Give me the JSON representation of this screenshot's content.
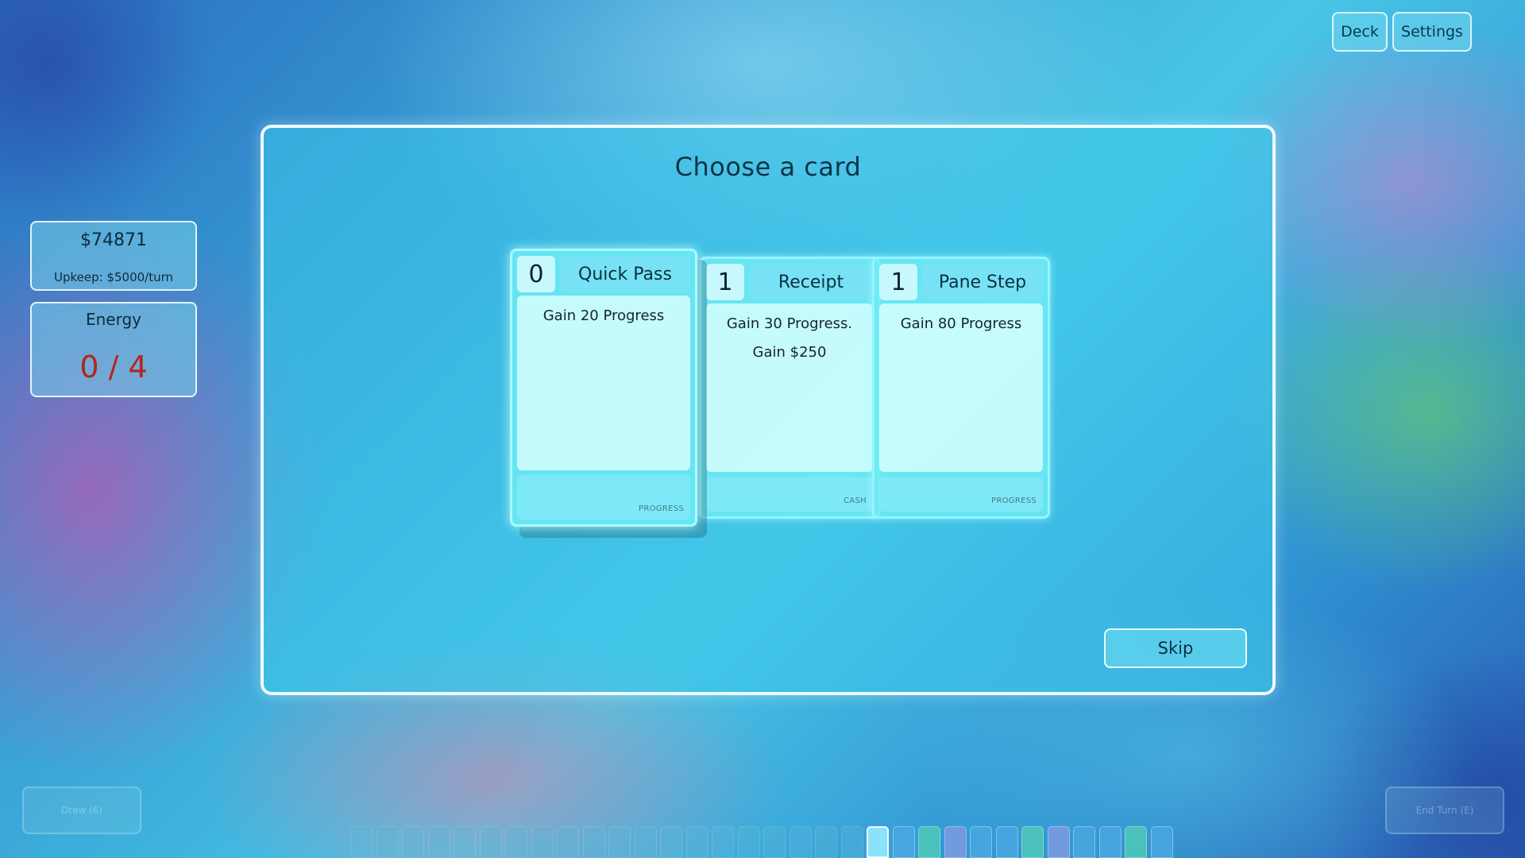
{
  "top_bar": {
    "deck_label": "Deck",
    "settings_label": "Settings"
  },
  "stats": {
    "money": "$74871",
    "upkeep": "Upkeep: $5000/turn",
    "energy_label": "Energy",
    "energy_value": "0 / 4"
  },
  "modal": {
    "title": "Choose a card",
    "skip_label": "Skip",
    "cards": [
      {
        "cost": "0",
        "name": "Quick Pass",
        "text": "Gain 20 Progress",
        "tag": "PROGRESS"
      },
      {
        "cost": "1",
        "name": "Receipt",
        "text": "Gain 30 Progress. Gain $250",
        "tag": "CASH"
      },
      {
        "cost": "1",
        "name": "Pane Step",
        "text": "Gain 80 Progress",
        "tag": "PROGRESS"
      }
    ]
  },
  "bottom": {
    "draw_label": "Draw (6)",
    "end_turn_label": "End Turn (E)"
  },
  "track": {
    "cell_count": 32,
    "current_index": 20,
    "colors": {
      "empty": "#5fb7d6",
      "current": "#8fe6ff",
      "blue": "#4aa8e0",
      "teal": "#4fc9b8",
      "purple": "#7d9be0"
    },
    "filled": [
      "blue",
      "teal",
      "purple",
      "blue",
      "blue",
      "teal",
      "purple",
      "blue",
      "blue",
      "teal",
      "blue"
    ]
  }
}
